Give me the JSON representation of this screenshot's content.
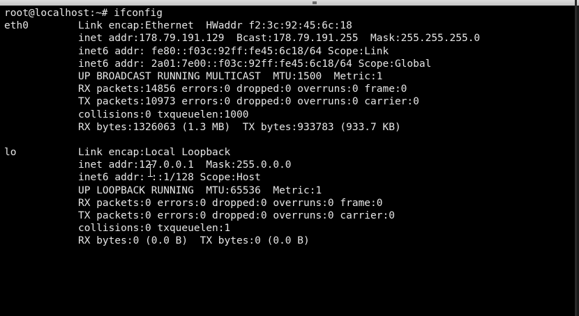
{
  "terminal": {
    "prompt": "root@localhost:~# ",
    "command": "ifconfig",
    "interfaces": [
      {
        "name": "eth0",
        "lines": [
          "Link encap:Ethernet  HWaddr f2:3c:92:45:6c:18",
          "inet addr:178.79.191.129  Bcast:178.79.191.255  Mask:255.255.255.0",
          "inet6 addr: fe80::f03c:92ff:fe45:6c18/64 Scope:Link",
          "inet6 addr: 2a01:7e00::f03c:92ff:fe45:6c18/64 Scope:Global",
          "UP BROADCAST RUNNING MULTICAST  MTU:1500  Metric:1",
          "RX packets:14856 errors:0 dropped:0 overruns:0 frame:0",
          "TX packets:10973 errors:0 dropped:0 overruns:0 carrier:0",
          "collisions:0 txqueuelen:1000",
          "RX bytes:1326063 (1.3 MB)  TX bytes:933783 (933.7 KB)"
        ]
      },
      {
        "name": "lo",
        "lines": [
          "Link encap:Local Loopback",
          "inet addr:127.0.0.1  Mask:255.0.0.0",
          "inet6 addr: ::1/128 Scope:Host",
          "UP LOOPBACK RUNNING  MTU:65536  Metric:1",
          "RX packets:0 errors:0 dropped:0 overruns:0 frame:0",
          "TX packets:0 errors:0 dropped:0 overruns:0 carrier:0",
          "collisions:0 txqueuelen:1",
          "RX bytes:0 (0.0 B)  TX bytes:0 (0.0 B)"
        ]
      }
    ]
  },
  "colors": {
    "background": "#000000",
    "text": "#e6e6e6"
  },
  "icons": {
    "cursor": "text-cursor-icon"
  }
}
